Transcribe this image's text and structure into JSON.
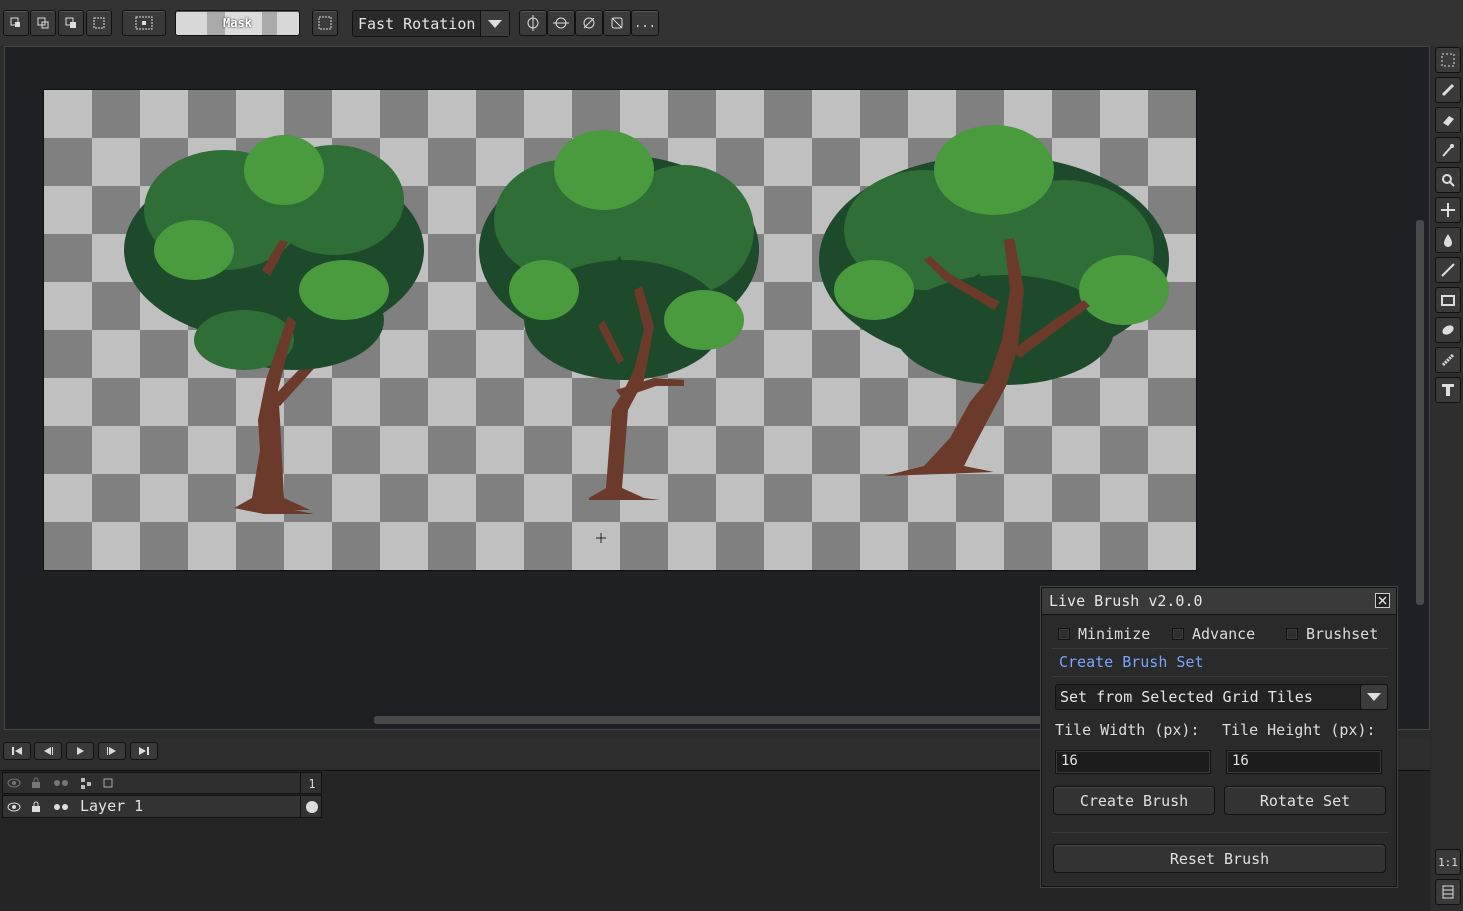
{
  "toolbar": {
    "mask_label": "Mask",
    "rotation_mode": "Fast Rotation",
    "more_label": "..."
  },
  "canvas": {
    "checker_light": "#c0c0c0",
    "checker_dark": "#808080",
    "objects": [
      "tree",
      "tree",
      "tree"
    ]
  },
  "layers": {
    "frame_number": "1",
    "items": [
      {
        "name": "Layer 1"
      }
    ]
  },
  "live_brush": {
    "title": "Live Brush v2.0.0",
    "checkboxes": {
      "minimize": "Minimize",
      "advance": "Advance",
      "brushset": "Brushset"
    },
    "section_link": "Create Brush Set",
    "mode_selected": "Set from Selected Grid Tiles",
    "tile_width_label": "Tile Width (px):",
    "tile_height_label": "Tile Height (px):",
    "tile_width_value": "16",
    "tile_height_value": "16",
    "create_brush": "Create Brush",
    "rotate_set": "Rotate Set",
    "reset_brush": "Reset Brush"
  },
  "tools": [
    "marquee-icon",
    "pencil-icon",
    "eraser-icon",
    "eyedropper-icon",
    "zoom-icon",
    "move-icon",
    "bucket-icon",
    "line-icon",
    "rectangle-icon",
    "ellipse-icon",
    "spray-icon",
    "text-icon"
  ],
  "bottom_right": {
    "zoom_1to1": "1:1"
  },
  "colors": {
    "accent_link": "#76a7ff",
    "bark": "#6b3a2a",
    "leaf_dark": "#1e4a2c",
    "leaf_mid": "#2f6e36",
    "leaf_light": "#4a9a3e"
  }
}
